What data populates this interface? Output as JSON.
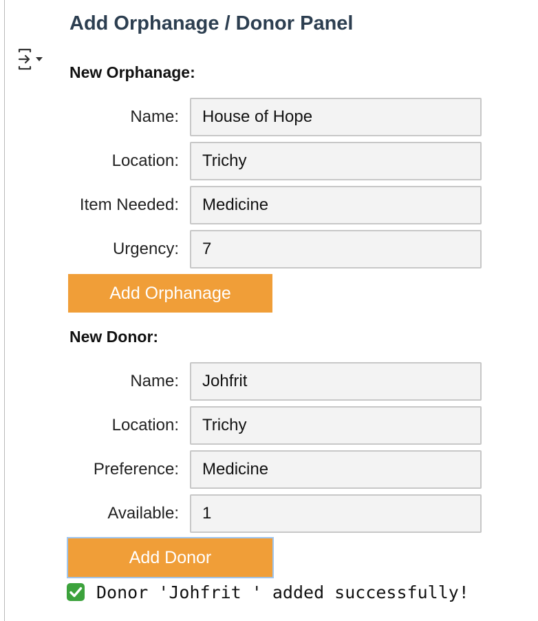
{
  "panel": {
    "title": "Add Orphanage / Donor Panel"
  },
  "toggle_icon": "collapse-sidebar-icon",
  "orphanage": {
    "heading": "New Orphanage:",
    "fields": [
      {
        "label": "Name:",
        "value": "House of Hope"
      },
      {
        "label": "Location:",
        "value": "Trichy"
      },
      {
        "label": "Item Needed:",
        "value": "Medicine"
      },
      {
        "label": "Urgency:",
        "value": "7"
      }
    ],
    "button_label": "Add Orphanage"
  },
  "donor": {
    "heading": "New Donor:",
    "fields": [
      {
        "label": "Name:",
        "value": "Johfrit"
      },
      {
        "label": "Location:",
        "value": "Trichy"
      },
      {
        "label": "Preference:",
        "value": "Medicine"
      },
      {
        "label": "Available:",
        "value": "1"
      }
    ],
    "button_label": "Add Donor"
  },
  "status": {
    "icon": "check-mark-icon",
    "message": "Donor 'Johfrit ' added successfully!"
  },
  "colors": {
    "button": "#f09e38",
    "title": "#2c3e50",
    "input_bg": "#f3f3f3",
    "success": "#3ca23c"
  }
}
